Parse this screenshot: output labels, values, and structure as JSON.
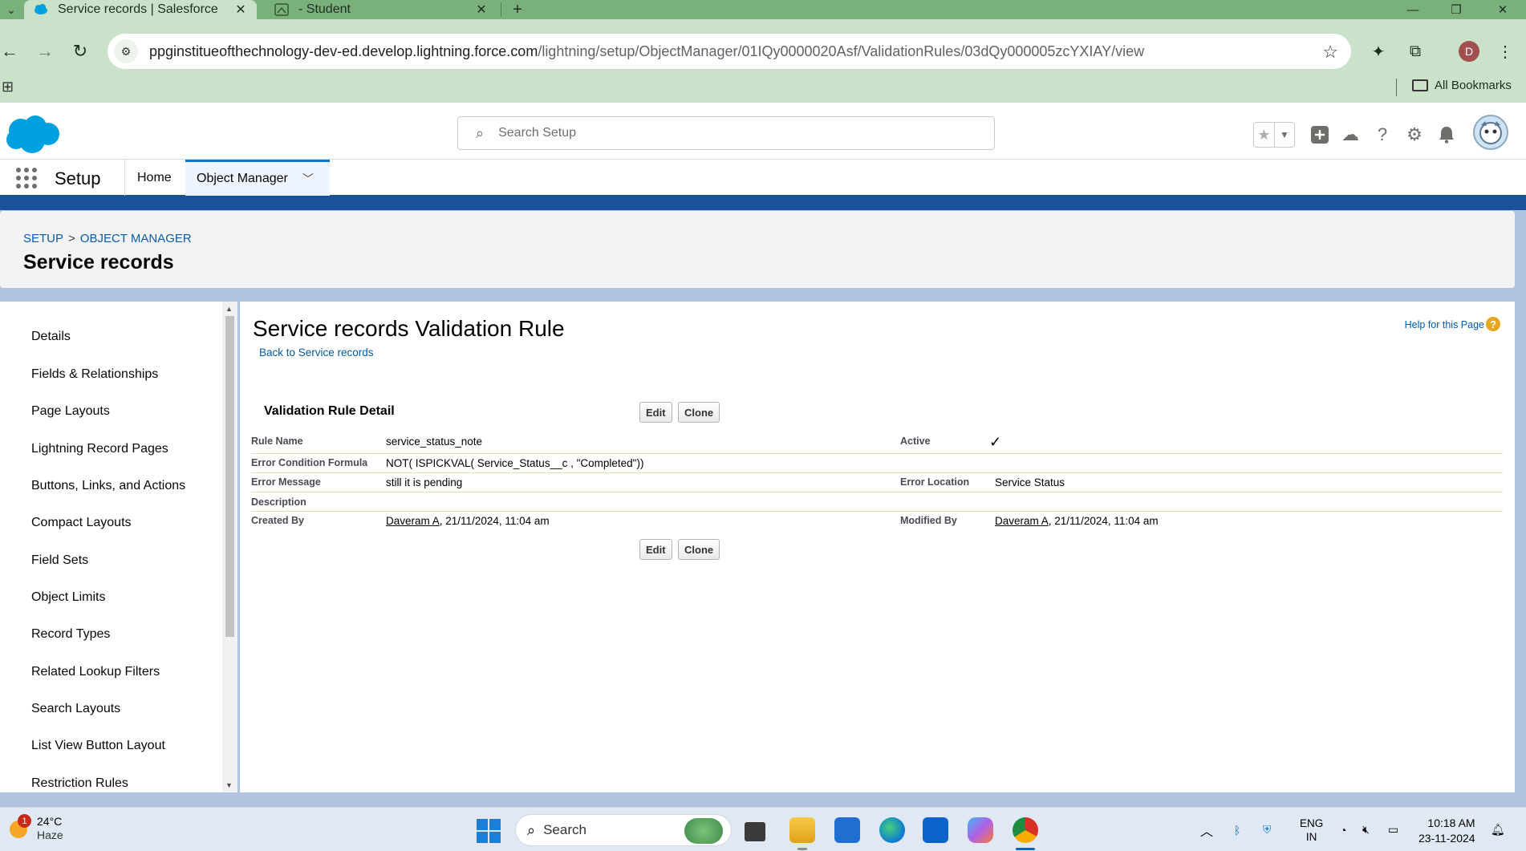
{
  "browser": {
    "tabs": [
      {
        "title": "Service records | Salesforce",
        "active": true
      },
      {
        "title": "- Student",
        "active": false
      }
    ],
    "new_tab_label": "+",
    "address": {
      "domain": "ppginstitueofthechnology-dev-ed.develop.lightning.force.com",
      "path": "/lightning/setup/ObjectManager/01IQy0000020Asf/ValidationRules/03dQy000005zcYXIAY/view"
    },
    "profile_initial": "D",
    "bookmarks": {
      "all_label": "All Bookmarks"
    }
  },
  "sf": {
    "search_placeholder": "Search Setup",
    "app_name": "Setup",
    "nav": {
      "home": "Home",
      "object_manager": "Object Manager"
    },
    "breadcrumb": {
      "setup": "SETUP",
      "separator": ">",
      "object_manager": "OBJECT MANAGER"
    },
    "page_title": "Service records",
    "sidebar": {
      "items": [
        "Details",
        "Fields & Relationships",
        "Page Layouts",
        "Lightning Record Pages",
        "Buttons, Links, and Actions",
        "Compact Layouts",
        "Field Sets",
        "Object Limits",
        "Record Types",
        "Related Lookup Filters",
        "Search Layouts",
        "List View Button Layout",
        "Restriction Rules"
      ]
    },
    "main": {
      "title": "Service records Validation Rule",
      "back_link": "Back to Service records",
      "help_link": "Help for this Page",
      "help_icon_label": "?",
      "section_title": "Validation Rule Detail",
      "edit_label": "Edit",
      "clone_label": "Clone",
      "fields": {
        "rule_name_label": "Rule Name",
        "rule_name": "service_status_note",
        "active_label": "Active",
        "active_check": "✓",
        "formula_label": "Error Condition Formula",
        "formula": "NOT( ISPICKVAL( Service_Status__c , \"Completed\"))",
        "message_label": "Error Message",
        "message": "still it is pending",
        "location_label": "Error Location",
        "location": "Service Status",
        "description_label": "Description",
        "created_label": "Created By",
        "created_user": "Daveram A",
        "created_date": ", 21/11/2024, 11:04 am",
        "modified_label": "Modified By",
        "modified_user": "Daveram A",
        "modified_date": ", 21/11/2024, 11:04 am"
      }
    }
  },
  "taskbar": {
    "weather_temp": "24°C",
    "weather_desc": "Haze",
    "weather_badge": "1",
    "search_label": "Search",
    "lang_top": "ENG",
    "lang_bottom": "IN",
    "time": "10:18 AM",
    "date": "23-11-2024"
  },
  "colors": {
    "sf_brand_blue": "#1b5297",
    "link_blue": "#015ba7",
    "chrome_green": "#79b07b"
  }
}
